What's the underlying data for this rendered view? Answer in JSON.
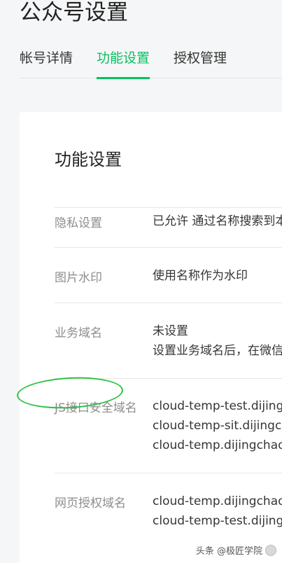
{
  "page": {
    "title": "公众号设置"
  },
  "tabs": [
    {
      "label": "帐号详情",
      "active": false
    },
    {
      "label": "功能设置",
      "active": true
    },
    {
      "label": "授权管理",
      "active": false
    }
  ],
  "section": {
    "title": "功能设置"
  },
  "settings": [
    {
      "label": "隐私设置",
      "lines": [
        "已允许 通过名称搜索到本"
      ]
    },
    {
      "label": "图片水印",
      "lines": [
        "使用名称作为水印"
      ]
    },
    {
      "label": "业务域名",
      "lines": [
        "未设置",
        "设置业务域名后，在微信"
      ]
    },
    {
      "label": "JS接口安全域名",
      "lines": [
        "cloud-temp-test.dijingc",
        "cloud-temp-sit.dijingch",
        "cloud-temp.dijingchao"
      ]
    },
    {
      "label": "网页授权域名",
      "lines": [
        "cloud-temp.dijingchao",
        "cloud-temp-test.dijingc"
      ]
    }
  ],
  "watermark": {
    "text": "头条 @极匠学院"
  },
  "colors": {
    "accent": "#07c160",
    "highlight_circle": "#2fbf45"
  }
}
